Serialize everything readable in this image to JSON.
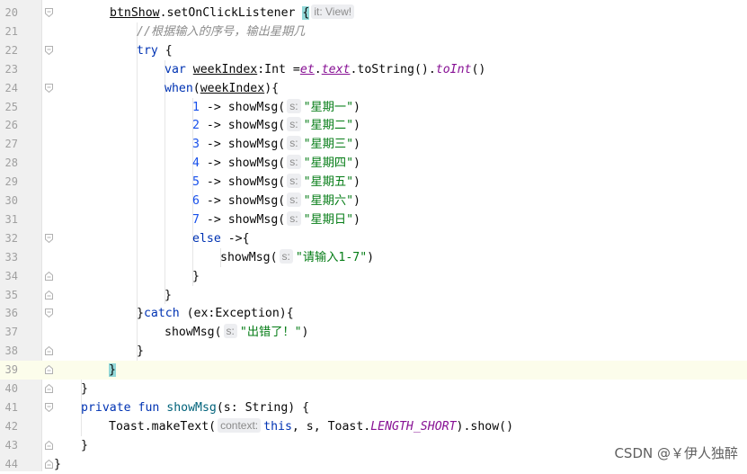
{
  "editor": {
    "lines": [
      {
        "n": "20",
        "toks": [
          [
            "v",
            "btnShow"
          ],
          [
            "p",
            "."
          ],
          [
            "p",
            "setOnClickListener "
          ],
          [
            "b",
            "{"
          ],
          [
            "h",
            "it: View!"
          ]
        ]
      },
      {
        "n": "21",
        "toks": [
          [
            "c",
            "//根据输入的序号，输出星期几"
          ]
        ]
      },
      {
        "n": "22",
        "toks": [
          [
            "k",
            "try"
          ],
          [
            "p",
            " {"
          ]
        ]
      },
      {
        "n": "23",
        "toks": [
          [
            "k",
            "var "
          ],
          [
            "u",
            "weekIndex"
          ],
          [
            "p",
            ":Int ="
          ],
          [
            "pu",
            "et"
          ],
          [
            "p",
            "."
          ],
          [
            "pu",
            "text"
          ],
          [
            "p",
            ".toString()."
          ],
          [
            "s",
            "toInt"
          ],
          [
            "p",
            "()"
          ]
        ]
      },
      {
        "n": "24",
        "toks": [
          [
            "k",
            "when"
          ],
          [
            "p",
            "("
          ],
          [
            "u",
            "weekIndex"
          ],
          [
            "p",
            "){"
          ]
        ]
      },
      {
        "n": "25",
        "toks": [
          [
            "num",
            "1"
          ],
          [
            "p",
            " -> showMsg("
          ],
          [
            "h",
            "s:"
          ],
          [
            "str",
            "\"星期一\""
          ],
          [
            "p",
            ")"
          ]
        ]
      },
      {
        "n": "26",
        "toks": [
          [
            "num",
            "2"
          ],
          [
            "p",
            " -> showMsg("
          ],
          [
            "h",
            "s:"
          ],
          [
            "str",
            "\"星期二\""
          ],
          [
            "p",
            ")"
          ]
        ]
      },
      {
        "n": "27",
        "toks": [
          [
            "num",
            "3"
          ],
          [
            "p",
            " -> showMsg("
          ],
          [
            "h",
            "s:"
          ],
          [
            "str",
            "\"星期三\""
          ],
          [
            "p",
            ")"
          ]
        ]
      },
      {
        "n": "28",
        "toks": [
          [
            "num",
            "4"
          ],
          [
            "p",
            " -> showMsg("
          ],
          [
            "h",
            "s:"
          ],
          [
            "str",
            "\"星期四\""
          ],
          [
            "p",
            ")"
          ]
        ]
      },
      {
        "n": "29",
        "toks": [
          [
            "num",
            "5"
          ],
          [
            "p",
            " -> showMsg("
          ],
          [
            "h",
            "s:"
          ],
          [
            "str",
            "\"星期五\""
          ],
          [
            "p",
            ")"
          ]
        ]
      },
      {
        "n": "30",
        "toks": [
          [
            "num",
            "6"
          ],
          [
            "p",
            " -> showMsg("
          ],
          [
            "h",
            "s:"
          ],
          [
            "str",
            "\"星期六\""
          ],
          [
            "p",
            ")"
          ]
        ]
      },
      {
        "n": "31",
        "toks": [
          [
            "num",
            "7"
          ],
          [
            "p",
            " -> showMsg("
          ],
          [
            "h",
            "s:"
          ],
          [
            "str",
            "\"星期日\""
          ],
          [
            "p",
            ")"
          ]
        ]
      },
      {
        "n": "32",
        "toks": [
          [
            "k",
            "else"
          ],
          [
            "p",
            " ->{"
          ]
        ]
      },
      {
        "n": "33",
        "toks": [
          [
            "p",
            "showMsg("
          ],
          [
            "h",
            "s:"
          ],
          [
            "str",
            "\"请输入1-7\""
          ],
          [
            "p",
            ")"
          ]
        ]
      },
      {
        "n": "34",
        "toks": [
          [
            "p",
            "}"
          ]
        ]
      },
      {
        "n": "35",
        "toks": [
          [
            "p",
            "}"
          ]
        ]
      },
      {
        "n": "36",
        "toks": [
          [
            "p",
            "}"
          ],
          [
            "k",
            "catch"
          ],
          [
            "p",
            " (ex:Exception){"
          ]
        ]
      },
      {
        "n": "37",
        "toks": [
          [
            "p",
            "showMsg("
          ],
          [
            "h",
            "s:"
          ],
          [
            "str",
            "\"出错了！\""
          ],
          [
            "p",
            ")"
          ]
        ]
      },
      {
        "n": "38",
        "toks": [
          [
            "p",
            "}"
          ]
        ]
      },
      {
        "n": "39",
        "toks": [
          [
            "b",
            "}"
          ]
        ]
      },
      {
        "n": "40",
        "toks": [
          [
            "p",
            "}"
          ]
        ]
      },
      {
        "n": "41",
        "toks": [
          [
            "k",
            "private fun "
          ],
          [
            "f",
            "showMsg"
          ],
          [
            "p",
            "(s: String) {"
          ]
        ]
      },
      {
        "n": "42",
        "toks": [
          [
            "p",
            "Toast.makeText("
          ],
          [
            "h",
            "context:"
          ],
          [
            "k",
            "this"
          ],
          [
            "p",
            ", s, Toast."
          ],
          [
            "st",
            "LENGTH_SHORT"
          ],
          [
            "p",
            ").show()"
          ]
        ]
      },
      {
        "n": "43",
        "toks": [
          [
            "p",
            "}"
          ]
        ]
      },
      {
        "n": "44",
        "toks": [
          [
            "p",
            "}"
          ]
        ]
      }
    ],
    "current_line": "39"
  },
  "watermark": "CSDN @￥伊人独醉",
  "colors": {
    "keyword": "#0033b3",
    "number": "#1750eb",
    "string": "#067d17",
    "comment": "#8c8c8c",
    "property": "#871094",
    "function": "#00627a",
    "gutter_bg": "#f0f0f0",
    "current_line_bg": "#fcfdeb",
    "brace_highlight": "#93d9d9"
  }
}
